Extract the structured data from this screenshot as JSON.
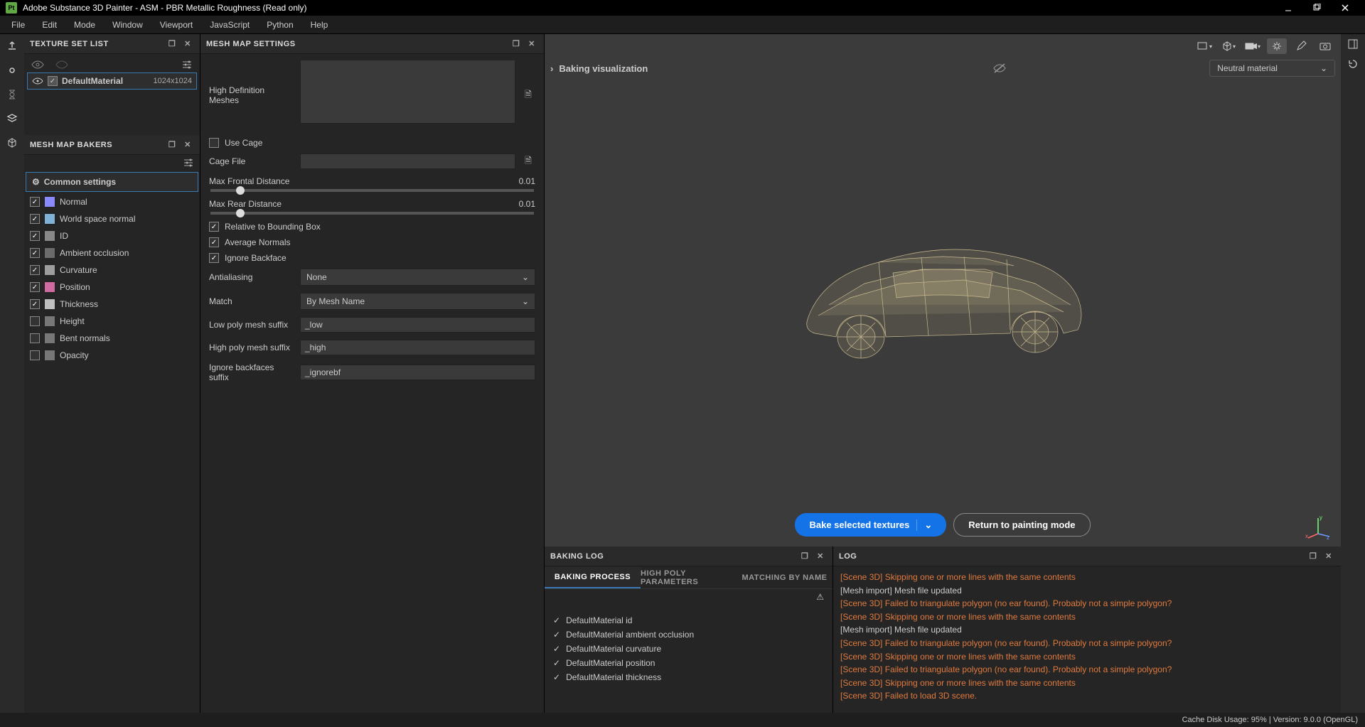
{
  "window": {
    "title": "Adobe Substance 3D Painter - ASM - PBR Metallic Roughness (Read only)"
  },
  "menu": {
    "items": [
      "File",
      "Edit",
      "Mode",
      "Window",
      "Viewport",
      "JavaScript",
      "Python",
      "Help"
    ]
  },
  "texture_set_list": {
    "title": "TEXTURE SET LIST",
    "item_name": "DefaultMaterial",
    "item_resolution": "1024x1024"
  },
  "mesh_map_bakers": {
    "title": "MESH MAP BAKERS",
    "common_label": "Common settings",
    "bakers": [
      {
        "label": "Normal",
        "checked": true,
        "color": "#8a8aff"
      },
      {
        "label": "World space normal",
        "checked": true,
        "color": "#7fb2d6"
      },
      {
        "label": "ID",
        "checked": true,
        "color": "#888888"
      },
      {
        "label": "Ambient occlusion",
        "checked": true,
        "color": "#6b6b6b"
      },
      {
        "label": "Curvature",
        "checked": true,
        "color": "#9d9d9d"
      },
      {
        "label": "Position",
        "checked": true,
        "color": "#d06aa0"
      },
      {
        "label": "Thickness",
        "checked": true,
        "color": "#bfbfbf"
      },
      {
        "label": "Height",
        "checked": false,
        "color": "#777777"
      },
      {
        "label": "Bent normals",
        "checked": false,
        "color": "#777777"
      },
      {
        "label": "Opacity",
        "checked": false,
        "color": "#777777"
      }
    ]
  },
  "mesh_map_settings": {
    "title": "MESH MAP SETTINGS",
    "hd_meshes_label": "High Definition Meshes",
    "use_cage_label": "Use Cage",
    "cage_file_label": "Cage File",
    "max_frontal_label": "Max Frontal Distance",
    "max_frontal_value": "0.01",
    "max_rear_label": "Max Rear Distance",
    "max_rear_value": "0.01",
    "relative_bbox_label": "Relative to Bounding Box",
    "average_normals_label": "Average Normals",
    "ignore_backface_label": "Ignore Backface",
    "antialiasing_label": "Antialiasing",
    "antialiasing_value": "None",
    "match_label": "Match",
    "match_value": "By Mesh Name",
    "low_suffix_label": "Low poly mesh suffix",
    "low_suffix_value": "_low",
    "high_suffix_label": "High poly mesh suffix",
    "high_suffix_value": "_high",
    "ignore_bf_suffix_label": "Ignore backfaces suffix",
    "ignore_bf_suffix_value": "_ignorebf"
  },
  "viewport": {
    "baking_visualization_label": "Baking visualization",
    "material_select": "Neutral material",
    "bake_button": "Bake selected textures",
    "return_button": "Return to painting mode"
  },
  "baking_log": {
    "title": "BAKING LOG",
    "tabs": [
      "BAKING PROCESS",
      "HIGH POLY PARAMETERS",
      "MATCHING BY NAME"
    ],
    "items": [
      "DefaultMaterial id",
      "DefaultMaterial ambient occlusion",
      "DefaultMaterial curvature",
      "DefaultMaterial position",
      "DefaultMaterial thickness"
    ]
  },
  "log": {
    "title": "LOG",
    "lines": [
      {
        "type": "error",
        "text": "[Scene 3D] Skipping one or more lines with the same contents"
      },
      {
        "type": "info",
        "text": "[Mesh import] Mesh file updated"
      },
      {
        "type": "error",
        "text": "[Scene 3D] Failed to triangulate polygon (no ear found). Probably not a simple polygon?"
      },
      {
        "type": "error",
        "text": "[Scene 3D] Skipping one or more lines with the same contents"
      },
      {
        "type": "info",
        "text": "[Mesh import] Mesh file updated"
      },
      {
        "type": "error",
        "text": "[Scene 3D] Failed to triangulate polygon (no ear found). Probably not a simple polygon?"
      },
      {
        "type": "error",
        "text": "[Scene 3D] Skipping one or more lines with the same contents"
      },
      {
        "type": "error",
        "text": "[Scene 3D] Failed to triangulate polygon (no ear found). Probably not a simple polygon?"
      },
      {
        "type": "error",
        "text": "[Scene 3D] Skipping one or more lines with the same contents"
      },
      {
        "type": "error",
        "text": "[Scene 3D] Failed to load 3D scene."
      }
    ]
  },
  "statusbar": {
    "text": "Cache Disk Usage:  95% | Version: 9.0.0 (OpenGL)"
  }
}
